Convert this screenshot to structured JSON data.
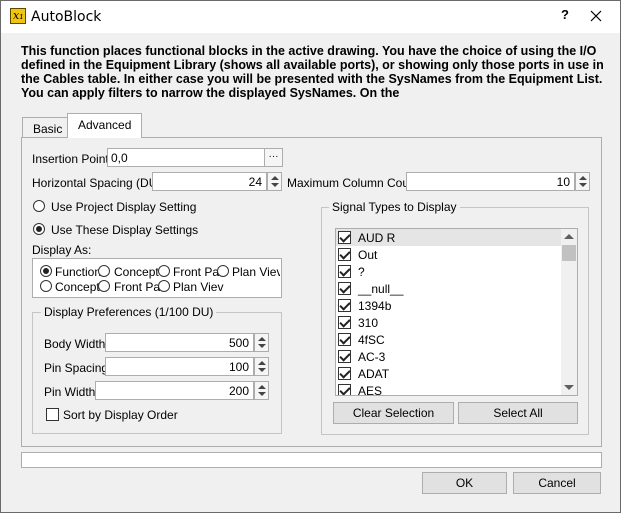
{
  "window": {
    "title": "AutoBlock",
    "help_label": "?",
    "app_icon_text": "x₁"
  },
  "description": "This function places functional blocks in the active drawing. You have the choice of using the I/O defined in the Equipment Library (shows all available ports), or showing only those ports in use in the Cables table. In either case you will be presented with the SysNames from the Equipment List. You can apply filters to narrow the displayed SysNames. On the",
  "tabs": [
    {
      "label": "Basic",
      "active": false
    },
    {
      "label": "Advanced",
      "active": true
    }
  ],
  "insertion_point": {
    "label": "Insertion Point",
    "value": "0,0",
    "browse_label": "···"
  },
  "horizontal_spacing": {
    "label": "Horizontal Spacing (DU)",
    "value": "24"
  },
  "max_column_count": {
    "label": "Maximum Column Count",
    "value": "10"
  },
  "display_setting": {
    "project_label": "Use Project Display Setting",
    "these_label": "Use These Display Settings",
    "selected": "these"
  },
  "display_as": {
    "label": "Display As:",
    "options": [
      {
        "label": "Function",
        "selected": true
      },
      {
        "label": "Concept",
        "selected": false
      },
      {
        "label": "Front Pa",
        "selected": false
      },
      {
        "label": "Plan Viev",
        "selected": false
      },
      {
        "label": "Concept",
        "selected": false
      },
      {
        "label": "Front Pa",
        "selected": false
      },
      {
        "label": "Plan Viev",
        "selected": false
      }
    ]
  },
  "display_prefs": {
    "title": "Display Preferences (1/100 DU)",
    "body_width": {
      "label": "Body Width",
      "value": "500"
    },
    "pin_spacing": {
      "label": "Pin Spacing",
      "value": "100"
    },
    "pin_width": {
      "label": "Pin Width",
      "value": "200"
    },
    "sort_label": "Sort by Display Order",
    "sort_checked": false
  },
  "signal_types": {
    "title": "Signal Types to Display",
    "items": [
      {
        "label": "AUD R",
        "checked": true
      },
      {
        "label": "Out",
        "checked": true
      },
      {
        "label": "?",
        "checked": true
      },
      {
        "label": "__null__",
        "checked": true
      },
      {
        "label": "1394b",
        "checked": true
      },
      {
        "label": "310",
        "checked": true
      },
      {
        "label": "4fSC",
        "checked": true
      },
      {
        "label": "AC-3",
        "checked": true
      },
      {
        "label": "ADAT",
        "checked": true
      },
      {
        "label": "AES",
        "checked": true
      }
    ],
    "clear_label": "Clear Selection",
    "select_all_label": "Select All"
  },
  "footer": {
    "ok_label": "OK",
    "cancel_label": "Cancel"
  }
}
